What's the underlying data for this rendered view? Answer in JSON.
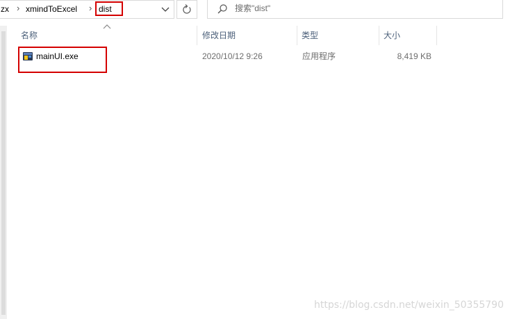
{
  "address_bar": {
    "crumbs": [
      "zx",
      "xmindToExcel",
      "dist"
    ],
    "separator": "›"
  },
  "search": {
    "placeholder": "搜索\"dist\""
  },
  "columns": {
    "name": "名称",
    "date_modified": "修改日期",
    "type": "类型",
    "size": "大小"
  },
  "files": [
    {
      "name": "mainUI.exe",
      "date_modified": "2020/10/12 9:26",
      "type": "应用程序",
      "size": "8,419 KB",
      "icon": "exe-icon"
    }
  ],
  "watermark": "https://blog.csdn.net/weixin_50355790",
  "colors": {
    "highlight": "#d40000",
    "header_text": "#4c607a",
    "secondary_text": "#6d6d6d"
  }
}
